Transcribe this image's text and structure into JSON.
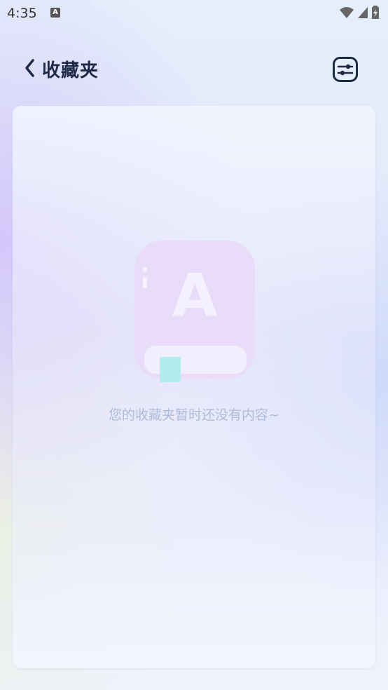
{
  "status_bar": {
    "time": "4:35",
    "notification_letter": "A"
  },
  "header": {
    "title": "收藏夹"
  },
  "empty_state": {
    "icon_letter": "A",
    "message": "您的收藏夹暂时还没有内容~"
  },
  "colors": {
    "title": "#1e2a45",
    "empty_text": "#aebcda",
    "book": "#e6dcf8",
    "bookmark": "#b3ecee"
  }
}
